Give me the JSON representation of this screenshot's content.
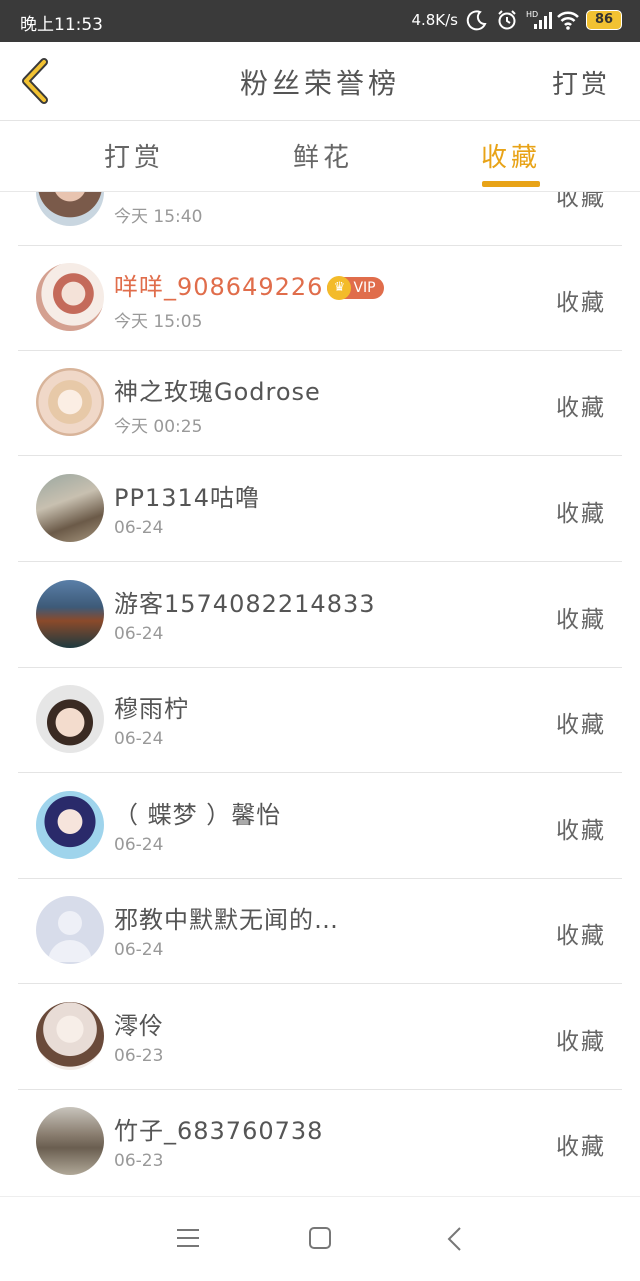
{
  "status_bar": {
    "time": "晚上11:53",
    "network_speed": "4.8K/s",
    "battery": "86",
    "icons": [
      "moon-icon",
      "alarm-icon",
      "hd-signal-icon",
      "wifi-icon",
      "battery-icon"
    ]
  },
  "header": {
    "title": "粉丝荣誉榜",
    "action": "打赏",
    "back_icon": "chevron-left-icon",
    "accent_color": "#e8a317"
  },
  "tabs": [
    {
      "label": "打赏",
      "active": false
    },
    {
      "label": "鲜花",
      "active": false
    },
    {
      "label": "收藏",
      "active": true
    }
  ],
  "list": [
    {
      "name": "",
      "date": "今天 15:40",
      "action": "收藏",
      "vip": false
    },
    {
      "name": "咩咩_908649226",
      "date": "今天 15:05",
      "action": "收藏",
      "vip": true,
      "vip_label": "VIP"
    },
    {
      "name": "神之玫瑰Godrose",
      "date": "今天 00:25",
      "action": "收藏",
      "vip": false
    },
    {
      "name": "PP1314咕噜",
      "date": "06-24",
      "action": "收藏",
      "vip": false
    },
    {
      "name": "游客1574082214833",
      "date": "06-24",
      "action": "收藏",
      "vip": false
    },
    {
      "name": "穆雨柠",
      "date": "06-24",
      "action": "收藏",
      "vip": false
    },
    {
      "name": "（ 蝶梦 ）馨怡",
      "date": "06-24",
      "action": "收藏",
      "vip": false
    },
    {
      "name": "邪教中默默无闻的…",
      "date": "06-24",
      "action": "收藏",
      "vip": false
    },
    {
      "name": "澪伶",
      "date": "06-23",
      "action": "收藏",
      "vip": false
    },
    {
      "name": "竹子_683760738",
      "date": "06-23",
      "action": "收藏",
      "vip": false
    }
  ],
  "nav_bar": {
    "icons": [
      "menu-icon",
      "home-square-icon",
      "back-triangle-icon"
    ]
  }
}
